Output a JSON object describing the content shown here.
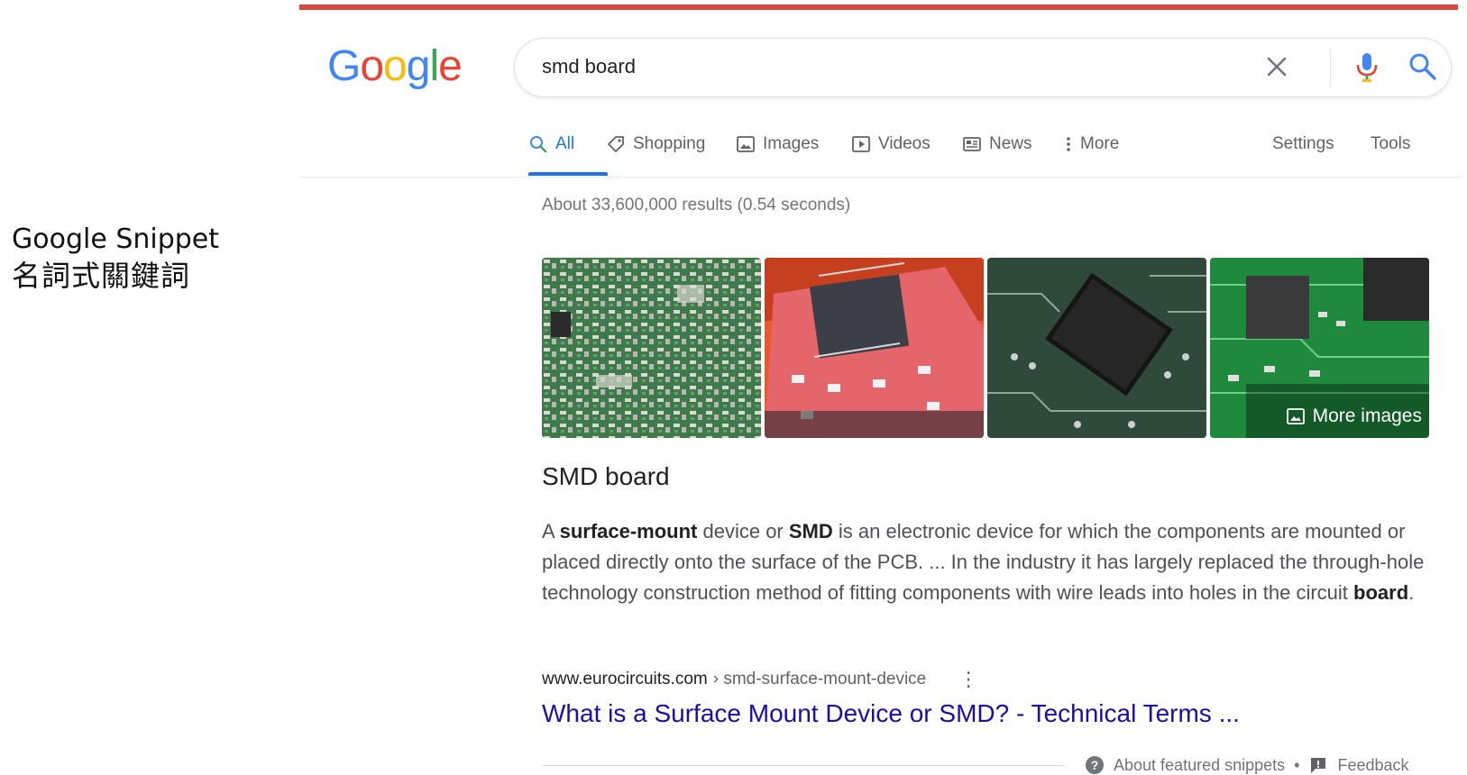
{
  "caption": {
    "line1": "Google Snippet",
    "line2": "名詞式關鍵詞"
  },
  "colors": {
    "accent_bar": "#d9483b",
    "link": "#1a0dab",
    "active_tab": "#1a73e8"
  },
  "logo": {
    "letters": [
      "G",
      "o",
      "o",
      "g",
      "l",
      "e"
    ]
  },
  "search": {
    "query": "smd board",
    "icons": [
      "close-icon",
      "microphone-icon",
      "search-icon"
    ]
  },
  "tabs": [
    {
      "label": "All",
      "icon": "search-icon",
      "active": true
    },
    {
      "label": "Shopping",
      "icon": "tag-icon"
    },
    {
      "label": "Images",
      "icon": "image-icon"
    },
    {
      "label": "Videos",
      "icon": "play-icon"
    },
    {
      "label": "News",
      "icon": "newspaper-icon"
    },
    {
      "label": "More",
      "icon": "dots-vertical-icon"
    }
  ],
  "tools": {
    "settings": "Settings",
    "tools": "Tools"
  },
  "results_stats": "About 33,600,000 results (0.54 seconds)",
  "images": {
    "more_label": "More images",
    "thumbnails": [
      "circuit-board-thumbnail",
      "red-pcb-chip-thumbnail",
      "black-chip-board-thumbnail",
      "green-pcb-thumbnail"
    ]
  },
  "snippet": {
    "title": "SMD board",
    "body": {
      "p1": "A ",
      "b1": "surface-mount",
      "p2": " device or ",
      "b2": "SMD",
      "p3": " is an electronic device for which the components are mounted or placed directly onto the surface of the PCB. ... In the industry it has largely replaced the through-hole technology construction method of fitting components with wire leads into holes in the circuit ",
      "b3": "board",
      "p4": "."
    },
    "cite_domain": "www.eurocircuits.com",
    "cite_path": "› smd-surface-mount-device",
    "link_text": "What is a Surface Mount Device or SMD? - Technical Terms ..."
  },
  "footer": {
    "about": "About featured snippets",
    "dot": "•",
    "feedback": "Feedback"
  }
}
